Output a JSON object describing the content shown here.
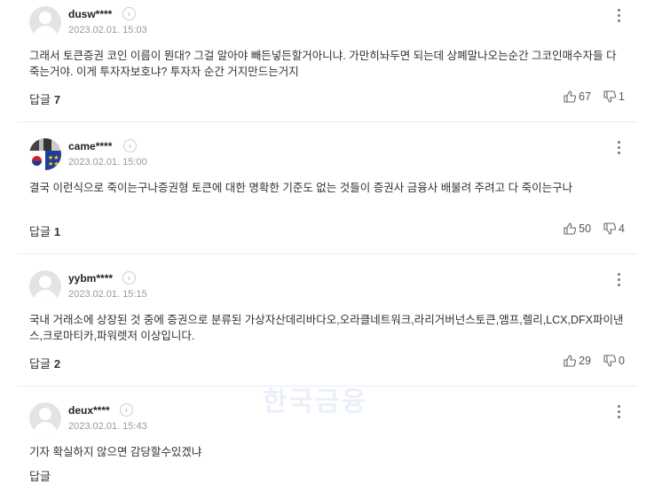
{
  "comments": [
    {
      "username": "dusw****",
      "time": "2023.02.01. 15:03",
      "text": "그래서 토큰증권 코인 이름이 뭔대? 그걸 알아야 빼든넣든할거아니냐. 가만히놔두면 되는데 상폐말나오는순간 그코인매수자들 다죽는거야. 이게 투자자보호냐? 투자자 순간 거지만드는거지",
      "reply_label": "답글",
      "reply_count": "7",
      "likes": "67",
      "dislikes": "1"
    },
    {
      "username": "came****",
      "time": "2023.02.01. 15:00",
      "text": "결국 이런식으로 죽이는구나증권형 토큰에 대한 명확한 기준도 없는 것들이 증권사 금융사 배불려 주려고 다 죽이는구나",
      "reply_label": "답글",
      "reply_count": "1",
      "likes": "50",
      "dislikes": "4"
    },
    {
      "username": "yybm****",
      "time": "2023.02.01. 15:15",
      "text": "국내 거래소에 상장된 것 중에 증권으로 분류된 가상자산데리바다오,오라클네트워크,라리거버넌스토큰,앰프,렐리,LCX,DFX파이낸스,크로마티카,파워렛저 이상입니다.",
      "reply_label": "답글",
      "reply_count": "2",
      "likes": "29",
      "dislikes": "0"
    },
    {
      "username": "deux****",
      "time": "2023.02.01. 15:43",
      "text": "기자 확실하지 않으면 감당할수있겠냐",
      "reply_label": "답글",
      "reply_count": "",
      "likes": "",
      "dislikes": ""
    }
  ],
  "watermark": "한국금융",
  "icons": {
    "avatar": "default-user-avatar",
    "profile": "chevron-right-circle-icon",
    "more": "vertical-ellipsis-icon",
    "like": "thumbs-up-icon",
    "dislike": "thumbs-down-icon"
  }
}
